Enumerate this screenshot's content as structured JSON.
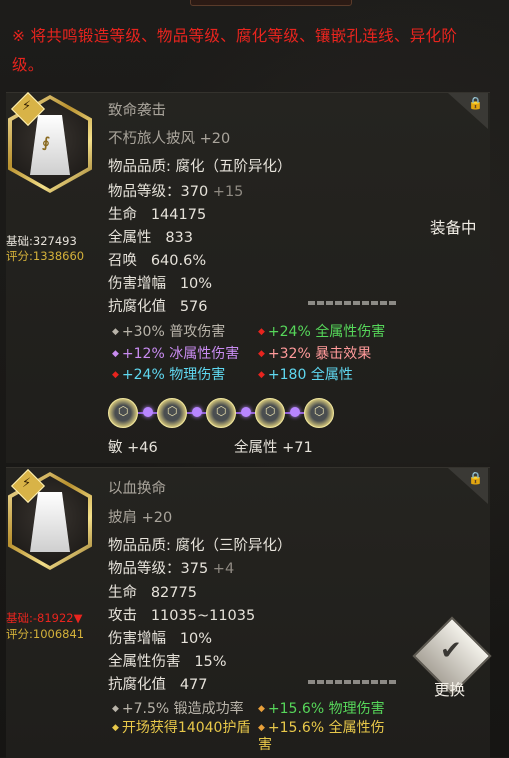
{
  "notice": "※ 将共鸣锻造等级、物品等级、腐化等级、镶嵌孔连线、异化阶级。",
  "item1": {
    "name": "致命袭击",
    "subname": "不朽旅人披风 +20",
    "quality_label": "物品品质: ",
    "quality_value": "腐化（五阶异化）",
    "level_label": "物品等级：",
    "level_value": "370",
    "level_bonus": "+15",
    "stats": [
      {
        "label": "生命",
        "value": "144175"
      },
      {
        "label": "全属性",
        "value": "833"
      },
      {
        "label": "召唤",
        "value": "640.6%"
      },
      {
        "label": "伤害增幅",
        "value": "10%"
      },
      {
        "label": "抗腐化值",
        "value": "576"
      }
    ],
    "base": "基础:327493",
    "score": "评分:1338660",
    "status": "装备中",
    "affixes_left": [
      {
        "text": "+30% 普攻伤害",
        "color": "#b9b4aa",
        "dot": "#b9b4aa"
      },
      {
        "text": "+12% 冰属性伤害",
        "color": "#c88bf0",
        "dot": "#c88bf0"
      },
      {
        "text": "+24% 物理伤害",
        "color": "#5fd8f0",
        "dot": "#e8241e"
      }
    ],
    "affixes_right": [
      {
        "text": "+24% 全属性伤害",
        "color": "#56d65a",
        "dot": "#e8241e"
      },
      {
        "text": "+32% 暴击效果",
        "color": "#ff9a9a",
        "dot": "#e8241e"
      },
      {
        "text": "+180 全属性",
        "color": "#5fd8f0",
        "dot": "#e8241e"
      }
    ],
    "gem_bonus_1": "敏  +46",
    "gem_bonus_2": "全属性  +71"
  },
  "item2": {
    "name": "以血换命",
    "subname": "披肩 +20",
    "quality_label": "物品品质: ",
    "quality_value": "腐化（三阶异化）",
    "level_label": "物品等级：",
    "level_value": "375",
    "level_bonus": "+4",
    "stats": [
      {
        "label": "生命",
        "value": "82775"
      },
      {
        "label": "攻击",
        "value": "11035~11035"
      },
      {
        "label": "伤害增幅",
        "value": "10%"
      },
      {
        "label": "全属性伤害",
        "value": "15%"
      },
      {
        "label": "抗腐化值",
        "value": "477"
      }
    ],
    "base": "基础:-81922▼",
    "score": "评分:1006841",
    "action": "更换",
    "affixes_left": [
      {
        "text": "+7.5% 锻造成功率",
        "color": "#b9b4aa",
        "dot": "#b9b4aa"
      },
      {
        "text": "开场获得14040护盾",
        "color": "#e8c84a",
        "dot": "#e8c84a"
      }
    ],
    "affixes_right": [
      {
        "text": "+15.6% 物理伤害",
        "color": "#56d65a",
        "dot": "#e8a03a"
      },
      {
        "text": "+15.6% 全属性伤害",
        "color": "#e8c84a",
        "dot": "#e8a03a"
      }
    ]
  },
  "icons": {
    "lock": "lock-icon",
    "badge": "resonance-badge-icon",
    "replace": "replace-check-icon"
  }
}
